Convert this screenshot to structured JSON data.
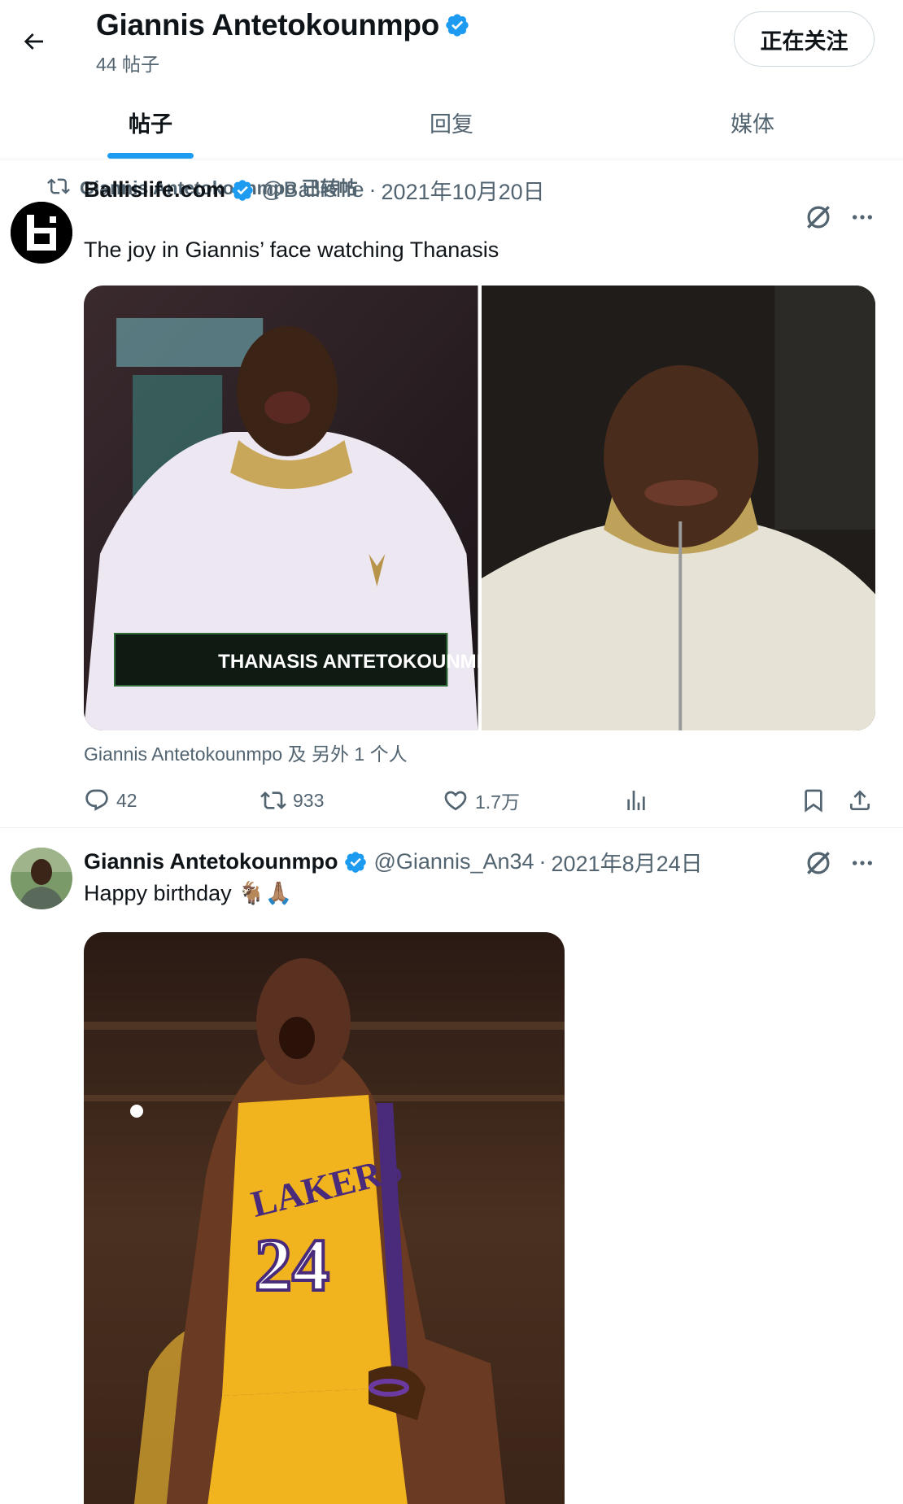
{
  "header": {
    "name": "Giannis Antetokounmpo",
    "post_count": "44 帖子",
    "follow_label": "正在关注"
  },
  "tabs": [
    {
      "label": "帖子",
      "active": true
    },
    {
      "label": "回复",
      "active": false
    },
    {
      "label": "媒体",
      "active": false
    }
  ],
  "tweets": [
    {
      "retweeted_by": "Giannis Antetokounmpo 已转帖",
      "display_name": "Ballislife.com",
      "handle": "@Ballislife",
      "separator": "·",
      "date": "2021年10月20日",
      "text": "The joy in Giannis’ face watching Thanasis",
      "media_caption_overlay": "THANASIS ANTETOKOUNMPO",
      "tagged": "Giannis Antetokounmpo 及 另外 1 个人",
      "replies": "42",
      "reposts": "933",
      "likes": "1.7万"
    },
    {
      "display_name": "Giannis Antetokounmpo",
      "handle": "@Giannis_An34",
      "separator": "·",
      "date": "2021年8月24日",
      "text": "Happy birthday 🐐🙏🏽",
      "jersey_text": "LAKERS",
      "jersey_number": "24"
    }
  ],
  "icons": {
    "back": "arrow-left-icon",
    "verified": "verified-badge-icon",
    "retweet": "retweet-icon",
    "grok": "grok-icon",
    "more": "more-icon",
    "reply": "reply-icon",
    "like": "heart-icon",
    "views": "views-icon",
    "bookmark": "bookmark-icon",
    "share": "share-icon"
  },
  "colors": {
    "accent": "#1d9bf0",
    "secondary_text": "#536471",
    "primary_text": "#0f1419"
  }
}
